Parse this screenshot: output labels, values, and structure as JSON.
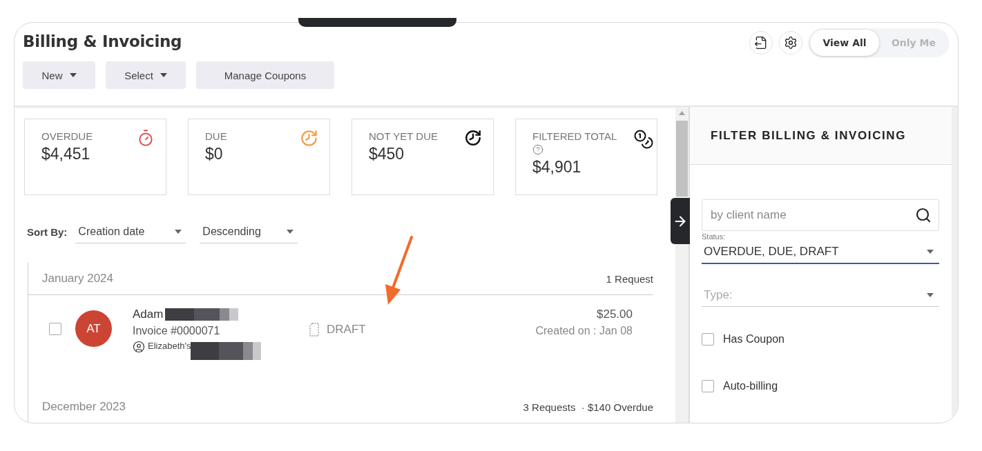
{
  "header": {
    "title": "Billing & Invoicing",
    "actions": [
      {
        "label": "New",
        "dropdown": true
      },
      {
        "label": "Select",
        "dropdown": true
      },
      {
        "label": "Manage Coupons",
        "dropdown": false
      }
    ],
    "view_toggle": [
      {
        "label": "View All",
        "selected": true
      },
      {
        "label": "Only Me",
        "selected": false
      }
    ]
  },
  "stats": [
    {
      "label": "OVERDUE",
      "value": "$4,451",
      "kind": "stopwatch",
      "help": false
    },
    {
      "label": "DUE",
      "value": "$0",
      "kind": "due",
      "help": false
    },
    {
      "label": "NOT YET DUE",
      "value": "$450",
      "kind": "upcoming",
      "help": false
    },
    {
      "label": "FILTERED TOTAL",
      "value": "$4,901",
      "kind": "total",
      "help": true
    }
  ],
  "sort": {
    "label": "Sort By:",
    "fields": [
      {
        "value": "Creation date"
      },
      {
        "value": "Descending"
      }
    ]
  },
  "groups": [
    {
      "month": "January 2024",
      "summary": "1 Request",
      "invoices": [
        {
          "initials": "AT",
          "name": "Adam",
          "name_redacted": true,
          "invoice": "Invoice #0000071",
          "client": "Elizabeth's",
          "client_redacted": true,
          "status": "DRAFT",
          "amount": "$25.00",
          "created": "Created on : Jan 08",
          "checked": false
        }
      ]
    },
    {
      "month": "December 2023",
      "summary": "3 Requests  · $140 Overdue"
    }
  ],
  "filter": {
    "title": "FILTER BILLING & INVOICING",
    "search": {
      "placeholder": "by client name"
    },
    "status": {
      "label": "Status:",
      "value": "OVERDUE, DUE, DRAFT",
      "focused": true
    },
    "type": {
      "placeholder": "Type:",
      "focused": false
    },
    "checkboxes": [
      {
        "label": "Has Coupon",
        "checked": false
      },
      {
        "label": "Auto-billing",
        "checked": false
      }
    ]
  }
}
